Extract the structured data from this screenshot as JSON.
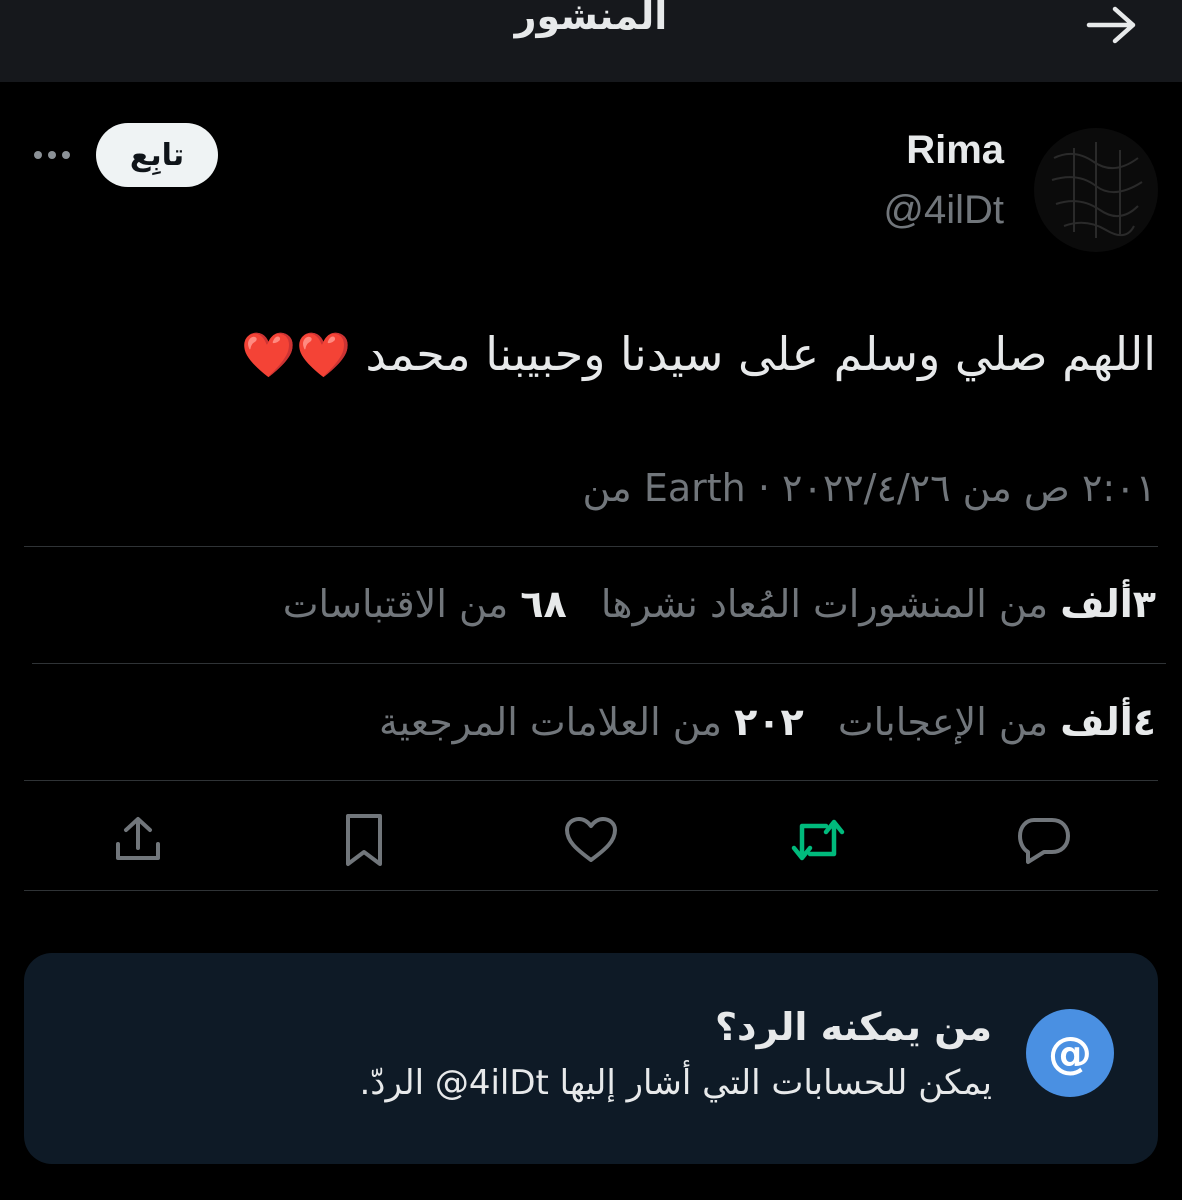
{
  "header": {
    "title": "المنشور"
  },
  "follow_label": "تابِع",
  "author": {
    "name": "Rima",
    "handle": "@4ilDt"
  },
  "post": {
    "text": "اللهم صلي وسلم على سيدنا وحبيبنا محمد",
    "emoji": "❤️❤️",
    "meta": "٢:٠١ ص من ٢٠٢٢/٤/٢٦ · Earth من"
  },
  "stats_row1": [
    {
      "count": "٣ألف",
      "label": "من المنشورات المُعاد نشرها"
    },
    {
      "count": "٦٨",
      "label": "من الاقتباسات"
    }
  ],
  "stats_row2": [
    {
      "count": "٤ألف",
      "label": "من الإعجابات"
    },
    {
      "count": "٢٠٢",
      "label": "من العلامات المرجعية"
    }
  ],
  "actions": {
    "reply_icon": "reply-icon",
    "repost_icon": "repost-icon",
    "like_icon": "heart-icon",
    "bookmark_icon": "bookmark-icon",
    "share_icon": "share-icon",
    "repost_color": "#00ba7c",
    "icon_color": "#71767b"
  },
  "reply_restriction": {
    "title": "من يمكنه الرد؟",
    "description": "يمكن للحسابات التي أشار إليها ‎@4ilDt‏ الردّ.",
    "icon": "@",
    "icon_color": "#4a90e2"
  }
}
